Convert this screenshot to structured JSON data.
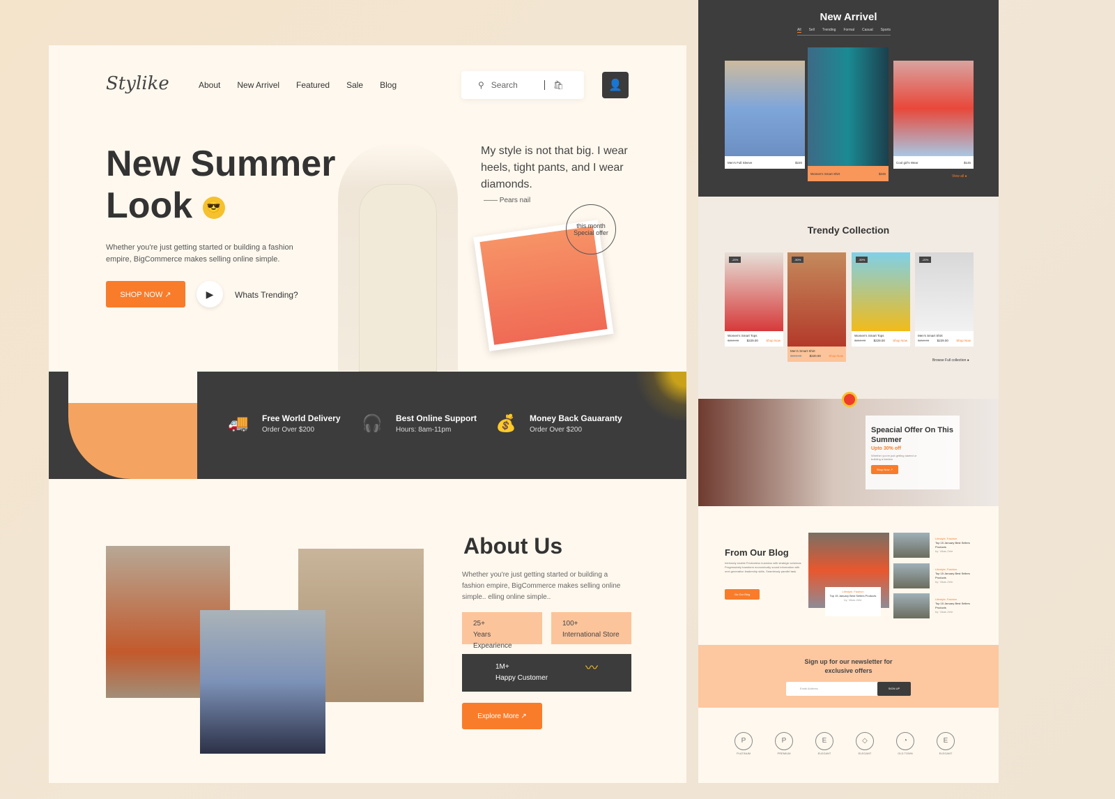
{
  "brand": "Stylike",
  "nav": [
    "About",
    "New Arrivel",
    "Featured",
    "Sale",
    "Blog"
  ],
  "search": {
    "placeholder": "Search"
  },
  "hero": {
    "title_line1": "New Summer",
    "title_line2": "Look",
    "subtitle": "Whether you're just getting started or building a fashion empire, BigCommerce makes selling online simple.",
    "shop_now": "SHOP NOW ↗",
    "trending": "Whats Trending?",
    "quote": "My style is not that big. I wear heels, tight pants, and I wear diamonds.",
    "quote_author": "Pears nail",
    "stamp": "this month Special offer"
  },
  "features": [
    {
      "icon": "truck-icon",
      "title": "Free World Delivery",
      "sub": "Order Over $200"
    },
    {
      "icon": "headset-icon",
      "title": "Best Online Support",
      "sub": "Hours: 8am-11pm"
    },
    {
      "icon": "money-bag-icon",
      "title": "Money Back Gauaranty",
      "sub": "Order Over $200"
    }
  ],
  "about": {
    "title": "About Us",
    "text": "Whether you're just getting started or building a fashion empire, BigCommerce makes selling online simple.. elling online simple..",
    "stats": [
      {
        "value": "25+",
        "label": "Years Expearience"
      },
      {
        "value": "100+",
        "label": "International Store"
      },
      {
        "value": "1M+",
        "label": "Happy Customer"
      }
    ],
    "explore": "Explore More ↗"
  },
  "new_arrival": {
    "title": "New Arrivel",
    "tabs": [
      "All",
      "Sell",
      "Trending",
      "Formal",
      "Casual",
      "Sports"
    ],
    "items": [
      {
        "name": "Men's Full Sleeve",
        "price": "$220"
      },
      {
        "name": "Women's Smart Shirt",
        "price": "$245"
      },
      {
        "name": "Cool girl's Wear",
        "price": "$145"
      }
    ],
    "view_all": "View all"
  },
  "trendy": {
    "title": "Trendy Collection",
    "items": [
      {
        "badge": "-20%",
        "name": "Women's Smart Tops",
        "old": "$250.00",
        "price": "$229.00",
        "cta": "Shop Now"
      },
      {
        "badge": "-50%",
        "name": "Men's Smart Shirt",
        "old": "$250.00",
        "price": "$220.00",
        "cta": "Shop Now"
      },
      {
        "badge": "-50%",
        "name": "Women's Smart Tops",
        "old": "$250.00",
        "price": "$229.00",
        "cta": "Shop Now"
      },
      {
        "badge": "-20%",
        "name": "Men's Smart Shirt",
        "old": "$250.00",
        "price": "$229.00",
        "cta": "Shop Now"
      }
    ],
    "browse": "Browse Full collection"
  },
  "offer": {
    "title": "Speacial Offer On This Summer",
    "discount": "Upto 30% off",
    "text": "Whether you're just getting started or building a fashion",
    "cta": "Shop Now ↗"
  },
  "blog": {
    "title": "From Our Blog",
    "text": "Intrinsicly enable Frictionless business with strategic schemas Progressively transform economically sound information with next generation leadership skills. Seamlessly parallel task.",
    "cta": "Go Our Blog",
    "featured": {
      "tag": "Lifestyle, Fashion",
      "title": "Top 15 January Best Sellers Products",
      "by": "by: Vikas Zehr"
    },
    "posts": [
      {
        "tag": "Lifestyle, Fashion",
        "title": "Top 15 January Best Sellers Products",
        "by": "by: Vikas Zehr"
      },
      {
        "tag": "Lifestyle, Fashion",
        "title": "Top 15 January Best Sellers Products",
        "by": "by: Vikas Zehr"
      },
      {
        "tag": "Lifestyle, Fashion",
        "title": "Top 15 January Best Sellers Products",
        "by": "by: Vikas Zehr"
      }
    ]
  },
  "newsletter": {
    "title": "Sign up for our newsletter for exclusive offers",
    "placeholder": "Email Address",
    "button": "SIGN UP"
  },
  "partner_logos": [
    "PLATINUM",
    "PREMIUM",
    "ELEGANT",
    "ELEGANT",
    "OLD TOWN",
    "ELEGANT"
  ],
  "colors": {
    "accent": "#f97c2a",
    "dark": "#3c3c3c",
    "peach": "#fcc49b",
    "cream": "#fff8ee"
  }
}
